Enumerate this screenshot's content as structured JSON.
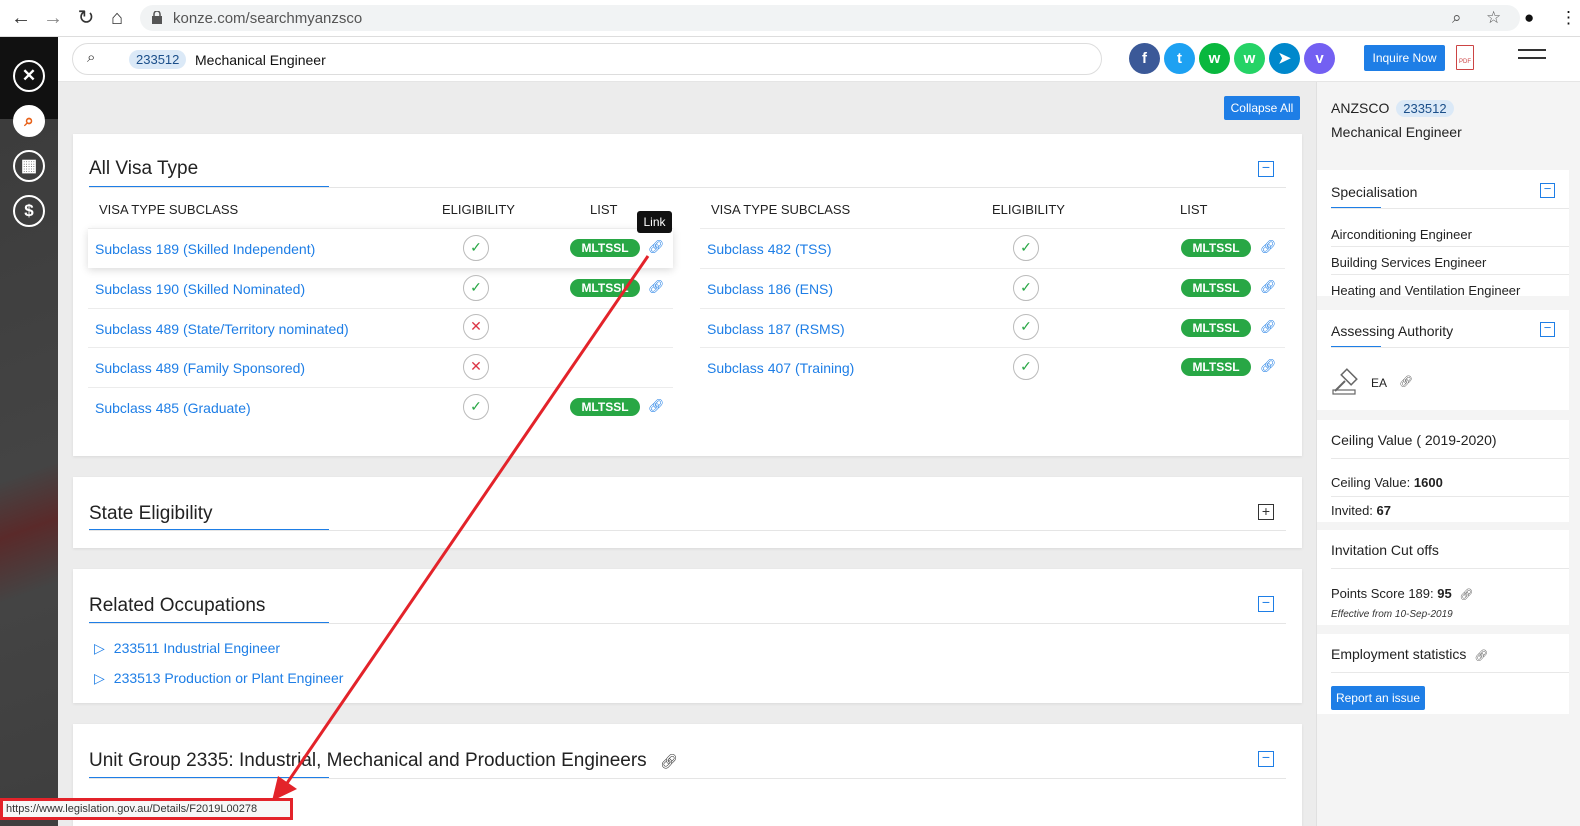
{
  "browser": {
    "url": "konze.com/searchmyanzsco",
    "back_icon": "arrow-left-icon",
    "forward_icon": "arrow-right-icon",
    "reload_icon": "reload-icon",
    "home_icon": "home-icon"
  },
  "rail": {
    "items": [
      {
        "icon": "close-icon",
        "glyph": "✕"
      },
      {
        "icon": "search-icon",
        "glyph": "⌕"
      },
      {
        "icon": "calculator-icon",
        "glyph": "▦"
      },
      {
        "icon": "dollar-icon",
        "glyph": "$"
      }
    ]
  },
  "header": {
    "search_code": "233512",
    "search_title": "Mechanical Engineer",
    "inquire_label": "Inquire Now",
    "pdf_label": "PDF",
    "social": [
      {
        "name": "facebook-icon",
        "glyph": "f",
        "color": "#3b5998"
      },
      {
        "name": "twitter-icon",
        "glyph": "t",
        "color": "#1da1f2"
      },
      {
        "name": "wechat-icon",
        "glyph": "w",
        "color": "#09b83e"
      },
      {
        "name": "whatsapp-icon",
        "glyph": "w",
        "color": "#25d366"
      },
      {
        "name": "telegram-icon",
        "glyph": "➤",
        "color": "#0088cc"
      },
      {
        "name": "viber-icon",
        "glyph": "v",
        "color": "#7360f2"
      }
    ]
  },
  "main": {
    "collapse_all": "Collapse All",
    "visa_card": {
      "title": "All Visa Type",
      "headers": {
        "subclass": "VISA TYPE SUBCLASS",
        "eligibility": "ELIGIBILITY",
        "list": "LIST"
      },
      "left_rows": [
        {
          "label": "Subclass 189 (Skilled Independent)",
          "eligible": true,
          "list": "MLTSSL"
        },
        {
          "label": "Subclass 190 (Skilled Nominated)",
          "eligible": true,
          "list": "MLTSSL"
        },
        {
          "label": "Subclass 489 (State/Territory nominated)",
          "eligible": false,
          "list": ""
        },
        {
          "label": "Subclass 489 (Family Sponsored)",
          "eligible": false,
          "list": ""
        },
        {
          "label": "Subclass 485 (Graduate)",
          "eligible": true,
          "list": "MLTSSL"
        }
      ],
      "right_rows": [
        {
          "label": "Subclass 482 (TSS)",
          "eligible": true,
          "list": "MLTSSL"
        },
        {
          "label": "Subclass 186 (ENS)",
          "eligible": true,
          "list": "MLTSSL"
        },
        {
          "label": "Subclass 187 (RSMS)",
          "eligible": true,
          "list": "MLTSSL"
        },
        {
          "label": "Subclass 407 (Training)",
          "eligible": true,
          "list": "MLTSSL"
        }
      ],
      "tooltip": "Link"
    },
    "state_card": {
      "title": "State Eligibility"
    },
    "related_card": {
      "title": "Related Occupations",
      "items": [
        "233511 Industrial Engineer",
        "233513 Production or Plant Engineer"
      ]
    },
    "unit_card": {
      "title": "Unit Group 2335: Industrial, Mechanical and Production Engineers"
    }
  },
  "sidebar": {
    "anzsco_label": "ANZSCO",
    "anzsco_code": "233512",
    "occupation": "Mechanical Engineer",
    "specialisation": {
      "title": "Specialisation",
      "items": [
        "Airconditioning Engineer",
        "Building Services Engineer",
        "Heating and Ventilation Engineer"
      ]
    },
    "assessing": {
      "title": "Assessing Authority",
      "authority": "EA"
    },
    "ceiling": {
      "title": "Ceiling Value ( 2019-2020)",
      "value_label": "Ceiling Value:",
      "value": "1600",
      "invited_label": "Invited:",
      "invited": "67"
    },
    "cutoffs": {
      "title": "Invitation Cut offs",
      "points_label": "Points Score 189:",
      "points": "95",
      "effective": "Effective from 10-Sep-2019"
    },
    "employment": {
      "title": "Employment statistics"
    },
    "report_label": "Report an issue"
  },
  "statusbar": {
    "url": "https://www.legislation.gov.au/Details/F2019L00278"
  },
  "colors": {
    "accent": "#1e7ee6",
    "success": "#28a745",
    "danger": "#dc3545",
    "annotation": "#e3232a"
  }
}
